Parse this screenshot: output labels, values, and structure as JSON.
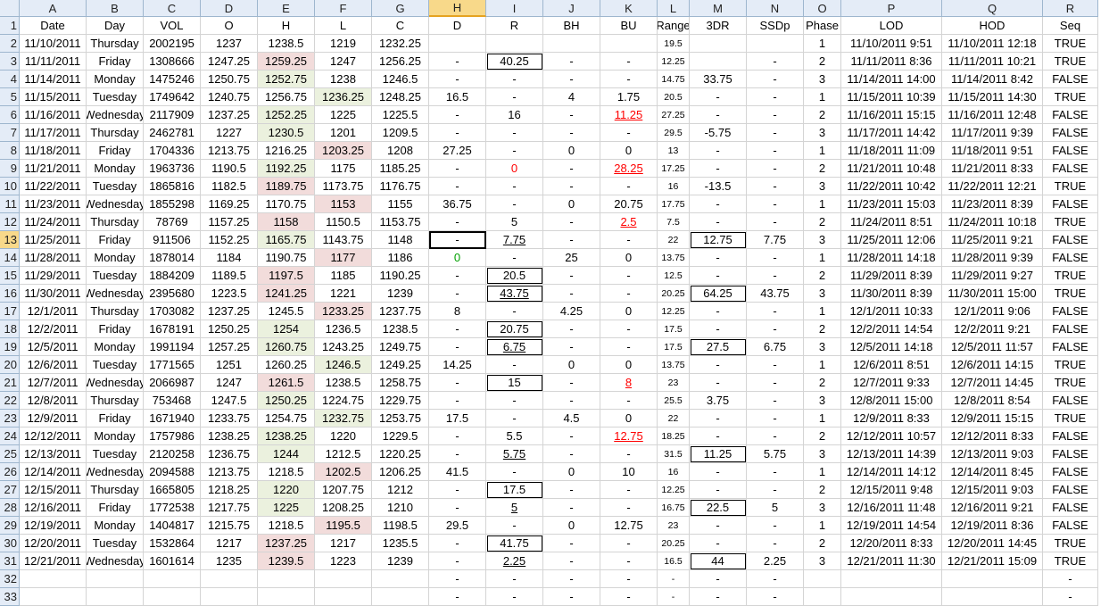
{
  "columns": [
    "A",
    "B",
    "C",
    "D",
    "E",
    "F",
    "G",
    "H",
    "I",
    "J",
    "K",
    "L",
    "M",
    "N",
    "O",
    "P",
    "Q",
    "R"
  ],
  "selected_column": "H",
  "selected_row": 13,
  "header_row": [
    "Date",
    "Day",
    "VOL",
    "O",
    "H",
    "L",
    "C",
    "D",
    "R",
    "BH",
    "BU",
    "Range",
    "3DR",
    "SSDp",
    "Phase",
    "LOD",
    "HOD",
    "Seq"
  ],
  "rows": [
    [
      "11/10/2011",
      "Thursday",
      "2002195",
      "1237",
      "1238.5",
      "1219",
      "1232.25",
      "",
      "",
      "",
      "",
      "19.5",
      "",
      "",
      "1",
      "11/10/2011 9:51",
      "11/10/2011 12:18",
      "TRUE"
    ],
    [
      "11/11/2011",
      "Friday",
      "1308666",
      "1247.25",
      "1259.25",
      "1247",
      "1256.25",
      "-",
      "40.25",
      "-",
      "-",
      "12.25",
      "",
      "-",
      "2",
      "11/11/2011 8:36",
      "11/11/2011 10:21",
      "TRUE"
    ],
    [
      "11/14/2011",
      "Monday",
      "1475246",
      "1250.75",
      "1252.75",
      "1238",
      "1246.5",
      "-",
      "-",
      "-",
      "-",
      "14.75",
      "33.75",
      "-",
      "3",
      "11/14/2011 14:00",
      "11/14/2011 8:42",
      "FALSE"
    ],
    [
      "11/15/2011",
      "Tuesday",
      "1749642",
      "1240.75",
      "1256.75",
      "1236.25",
      "1248.25",
      "16.5",
      "-",
      "4",
      "1.75",
      "20.5",
      "-",
      "-",
      "1",
      "11/15/2011 10:39",
      "11/15/2011 14:30",
      "TRUE"
    ],
    [
      "11/16/2011",
      "Wednesday",
      "2117909",
      "1237.25",
      "1252.25",
      "1225",
      "1225.5",
      "-",
      "16",
      "-",
      "11.25",
      "27.25",
      "-",
      "-",
      "2",
      "11/16/2011 15:15",
      "11/16/2011 12:48",
      "FALSE"
    ],
    [
      "11/17/2011",
      "Thursday",
      "2462781",
      "1227",
      "1230.5",
      "1201",
      "1209.5",
      "-",
      "-",
      "-",
      "-",
      "29.5",
      "-5.75",
      "-",
      "3",
      "11/17/2011 14:42",
      "11/17/2011 9:39",
      "FALSE"
    ],
    [
      "11/18/2011",
      "Friday",
      "1704336",
      "1213.75",
      "1216.25",
      "1203.25",
      "1208",
      "27.25",
      "-",
      "0",
      "0",
      "13",
      "-",
      "-",
      "1",
      "11/18/2011 11:09",
      "11/18/2011 9:51",
      "FALSE"
    ],
    [
      "11/21/2011",
      "Monday",
      "1963736",
      "1190.5",
      "1192.25",
      "1175",
      "1185.25",
      "-",
      "0",
      "-",
      "28.25",
      "17.25",
      "-",
      "-",
      "2",
      "11/21/2011 10:48",
      "11/21/2011 8:33",
      "FALSE"
    ],
    [
      "11/22/2011",
      "Tuesday",
      "1865816",
      "1182.5",
      "1189.75",
      "1173.75",
      "1176.75",
      "-",
      "-",
      "-",
      "-",
      "16",
      "-13.5",
      "-",
      "3",
      "11/22/2011 10:42",
      "11/22/2011 12:21",
      "TRUE"
    ],
    [
      "11/23/2011",
      "Wednesday",
      "1855298",
      "1169.25",
      "1170.75",
      "1153",
      "1155",
      "36.75",
      "-",
      "0",
      "20.75",
      "17.75",
      "-",
      "-",
      "1",
      "11/23/2011 15:03",
      "11/23/2011 8:39",
      "FALSE"
    ],
    [
      "11/24/2011",
      "Thursday",
      "78769",
      "1157.25",
      "1158",
      "1150.5",
      "1153.75",
      "-",
      "5",
      "-",
      "2.5",
      "7.5",
      "-",
      "-",
      "2",
      "11/24/2011 8:51",
      "11/24/2011 10:18",
      "TRUE"
    ],
    [
      "11/25/2011",
      "Friday",
      "911506",
      "1152.25",
      "1165.75",
      "1143.75",
      "1148",
      "-",
      "7.75",
      "-",
      "-",
      "22",
      "12.75",
      "7.75",
      "3",
      "11/25/2011 12:06",
      "11/25/2011 9:21",
      "FALSE"
    ],
    [
      "11/28/2011",
      "Monday",
      "1878014",
      "1184",
      "1190.75",
      "1177",
      "1186",
      "0",
      "-",
      "25",
      "0",
      "13.75",
      "-",
      "-",
      "1",
      "11/28/2011 14:18",
      "11/28/2011 9:39",
      "FALSE"
    ],
    [
      "11/29/2011",
      "Tuesday",
      "1884209",
      "1189.5",
      "1197.5",
      "1185",
      "1190.25",
      "-",
      "20.5",
      "-",
      "-",
      "12.5",
      "-",
      "-",
      "2",
      "11/29/2011 8:39",
      "11/29/2011 9:27",
      "TRUE"
    ],
    [
      "11/30/2011",
      "Wednesday",
      "2395680",
      "1223.5",
      "1241.25",
      "1221",
      "1239",
      "-",
      "43.75",
      "-",
      "-",
      "20.25",
      "64.25",
      "43.75",
      "3",
      "11/30/2011 8:39",
      "11/30/2011 15:00",
      "TRUE"
    ],
    [
      "12/1/2011",
      "Thursday",
      "1703082",
      "1237.25",
      "1245.5",
      "1233.25",
      "1237.75",
      "8",
      "-",
      "4.25",
      "0",
      "12.25",
      "-",
      "-",
      "1",
      "12/1/2011 10:33",
      "12/1/2011 9:06",
      "FALSE"
    ],
    [
      "12/2/2011",
      "Friday",
      "1678191",
      "1250.25",
      "1254",
      "1236.5",
      "1238.5",
      "-",
      "20.75",
      "-",
      "-",
      "17.5",
      "-",
      "-",
      "2",
      "12/2/2011 14:54",
      "12/2/2011 9:21",
      "FALSE"
    ],
    [
      "12/5/2011",
      "Monday",
      "1991194",
      "1257.25",
      "1260.75",
      "1243.25",
      "1249.75",
      "-",
      "6.75",
      "-",
      "-",
      "17.5",
      "27.5",
      "6.75",
      "3",
      "12/5/2011 14:18",
      "12/5/2011 11:57",
      "FALSE"
    ],
    [
      "12/6/2011",
      "Tuesday",
      "1771565",
      "1251",
      "1260.25",
      "1246.5",
      "1249.25",
      "14.25",
      "-",
      "0",
      "0",
      "13.75",
      "-",
      "-",
      "1",
      "12/6/2011 8:51",
      "12/6/2011 14:15",
      "TRUE"
    ],
    [
      "12/7/2011",
      "Wednesday",
      "2066987",
      "1247",
      "1261.5",
      "1238.5",
      "1258.75",
      "-",
      "15",
      "-",
      "8",
      "23",
      "-",
      "-",
      "2",
      "12/7/2011 9:33",
      "12/7/2011 14:45",
      "TRUE"
    ],
    [
      "12/8/2011",
      "Thursday",
      "753468",
      "1247.5",
      "1250.25",
      "1224.75",
      "1229.75",
      "-",
      "-",
      "-",
      "-",
      "25.5",
      "3.75",
      "-",
      "3",
      "12/8/2011 15:00",
      "12/8/2011 8:54",
      "FALSE"
    ],
    [
      "12/9/2011",
      "Friday",
      "1671940",
      "1233.75",
      "1254.75",
      "1232.75",
      "1253.75",
      "17.5",
      "-",
      "4.5",
      "0",
      "22",
      "-",
      "-",
      "1",
      "12/9/2011 8:33",
      "12/9/2011 15:15",
      "TRUE"
    ],
    [
      "12/12/2011",
      "Monday",
      "1757986",
      "1238.25",
      "1238.25",
      "1220",
      "1229.5",
      "-",
      "5.5",
      "-",
      "12.75",
      "18.25",
      "-",
      "-",
      "2",
      "12/12/2011 10:57",
      "12/12/2011 8:33",
      "FALSE"
    ],
    [
      "12/13/2011",
      "Tuesday",
      "2120258",
      "1236.75",
      "1244",
      "1212.5",
      "1220.25",
      "-",
      "5.75",
      "-",
      "-",
      "31.5",
      "11.25",
      "5.75",
      "3",
      "12/13/2011 14:39",
      "12/13/2011 9:03",
      "FALSE"
    ],
    [
      "12/14/2011",
      "Wednesday",
      "2094588",
      "1213.75",
      "1218.5",
      "1202.5",
      "1206.25",
      "41.5",
      "-",
      "0",
      "10",
      "16",
      "-",
      "-",
      "1",
      "12/14/2011 14:12",
      "12/14/2011 8:45",
      "FALSE"
    ],
    [
      "12/15/2011",
      "Thursday",
      "1665805",
      "1218.25",
      "1220",
      "1207.75",
      "1212",
      "-",
      "17.5",
      "-",
      "-",
      "12.25",
      "-",
      "-",
      "2",
      "12/15/2011 9:48",
      "12/15/2011 9:03",
      "FALSE"
    ],
    [
      "12/16/2011",
      "Friday",
      "1772538",
      "1217.75",
      "1225",
      "1208.25",
      "1210",
      "-",
      "5",
      "-",
      "-",
      "16.75",
      "22.5",
      "5",
      "3",
      "12/16/2011 11:48",
      "12/16/2011 9:21",
      "FALSE"
    ],
    [
      "12/19/2011",
      "Monday",
      "1404817",
      "1215.75",
      "1218.5",
      "1195.5",
      "1198.5",
      "29.5",
      "-",
      "0",
      "12.75",
      "23",
      "-",
      "-",
      "1",
      "12/19/2011 14:54",
      "12/19/2011 8:36",
      "FALSE"
    ],
    [
      "12/20/2011",
      "Tuesday",
      "1532864",
      "1217",
      "1237.25",
      "1217",
      "1235.5",
      "-",
      "41.75",
      "-",
      "-",
      "20.25",
      "-",
      "-",
      "2",
      "12/20/2011 8:33",
      "12/20/2011 14:45",
      "TRUE"
    ],
    [
      "12/21/2011",
      "Wednesday",
      "1601614",
      "1235",
      "1239.5",
      "1223",
      "1239",
      "-",
      "2.25",
      "-",
      "-",
      "16.5",
      "44",
      "2.25",
      "3",
      "12/21/2011 11:30",
      "12/21/2011 15:09",
      "TRUE"
    ],
    [
      "",
      "",
      "",
      "",
      "",
      "",
      "",
      "-",
      "-",
      "-",
      "-",
      "-",
      "-",
      "-",
      "",
      "",
      "",
      "-"
    ],
    [
      "",
      "",
      "",
      "",
      "",
      "",
      "",
      "-",
      "-",
      "-",
      "-",
      "-",
      "-",
      "-",
      "",
      "",
      "",
      "-"
    ]
  ],
  "colors": {
    "green_fill": "#ebf1de",
    "red_fill": "#f2dcdb",
    "header_bg": "#e4ecf7",
    "selected_header": "#f8d98a",
    "red_text": "#ff0000",
    "green_text": "#00a000"
  },
  "fills": {
    "3": {
      "4": "r"
    },
    "4": {
      "4": "g"
    },
    "5": {
      "5": "g"
    },
    "6": {
      "4": "g"
    },
    "7": {
      "4": "g"
    },
    "8": {
      "5": "r"
    },
    "9": {
      "4": "g"
    },
    "10": {
      "4": "r"
    },
    "11": {
      "5": "r"
    },
    "12": {
      "4": "r"
    },
    "13": {
      "4": "g"
    },
    "14": {
      "5": "r"
    },
    "15": {
      "4": "r"
    },
    "16": {
      "4": "r"
    },
    "17": {
      "5": "r"
    },
    "18": {
      "4": "g"
    },
    "19": {
      "4": "g"
    },
    "20": {
      "5": "g"
    },
    "21": {
      "4": "r"
    },
    "22": {
      "4": "g"
    },
    "23": {
      "5": "g"
    },
    "24": {
      "4": "g"
    },
    "25": {
      "4": "g"
    },
    "26": {
      "5": "r"
    },
    "27": {
      "4": "g"
    },
    "28": {
      "4": "g"
    },
    "29": {
      "5": "r"
    },
    "30": {
      "4": "r"
    },
    "31": {
      "4": "r"
    }
  },
  "boxed_cells": [
    "3-8",
    "13-12",
    "15-8",
    "16-8",
    "16-12",
    "18-8",
    "19-8",
    "19-12",
    "21-8",
    "25-12",
    "27-8",
    "28-12",
    "30-8",
    "31-12"
  ],
  "underline_cells": [
    "13-8",
    "16-8",
    "19-8",
    "25-8",
    "28-8",
    "31-8",
    "6-10",
    "9-10",
    "12-10",
    "21-10",
    "24-10"
  ],
  "red_text_cells": [
    "6-10",
    "9-10",
    "12-10",
    "21-10",
    "24-10",
    "9-8"
  ],
  "green_text_cells": [
    "14-7"
  ],
  "small_font_column": 11
}
